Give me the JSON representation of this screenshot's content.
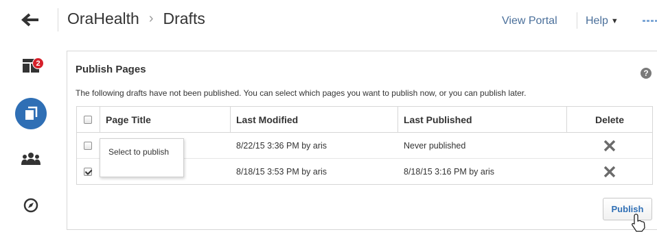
{
  "header": {
    "breadcrumb": {
      "root": "OraHealth",
      "separator": "›",
      "current": "Drafts"
    },
    "view_portal": "View Portal",
    "help": "Help",
    "help_caret": "▼"
  },
  "rail": {
    "badge_count": "2"
  },
  "panel": {
    "title": "Publish Pages",
    "help_icon": "?",
    "description": "The following drafts have not been published. You can select which pages you want to publish now, or you can publish later."
  },
  "table": {
    "headers": {
      "page_title": "Page Title",
      "last_modified": "Last Modified",
      "last_published": "Last Published",
      "delete": "Delete"
    },
    "rows": [
      {
        "checked": false,
        "page_title": "",
        "last_modified": "8/22/15 3:36 PM by aris",
        "last_published": "Never published"
      },
      {
        "checked": true,
        "page_title": "",
        "last_modified": "8/18/15 3:53 PM by aris",
        "last_published": "8/18/15 3:16 PM by aris"
      }
    ]
  },
  "tooltip": {
    "text": "Select to publish"
  },
  "publish_button": "Publish",
  "colors": {
    "accent": "#2f6fb5",
    "badge": "#d6202a",
    "link": "#4a6f9a"
  }
}
